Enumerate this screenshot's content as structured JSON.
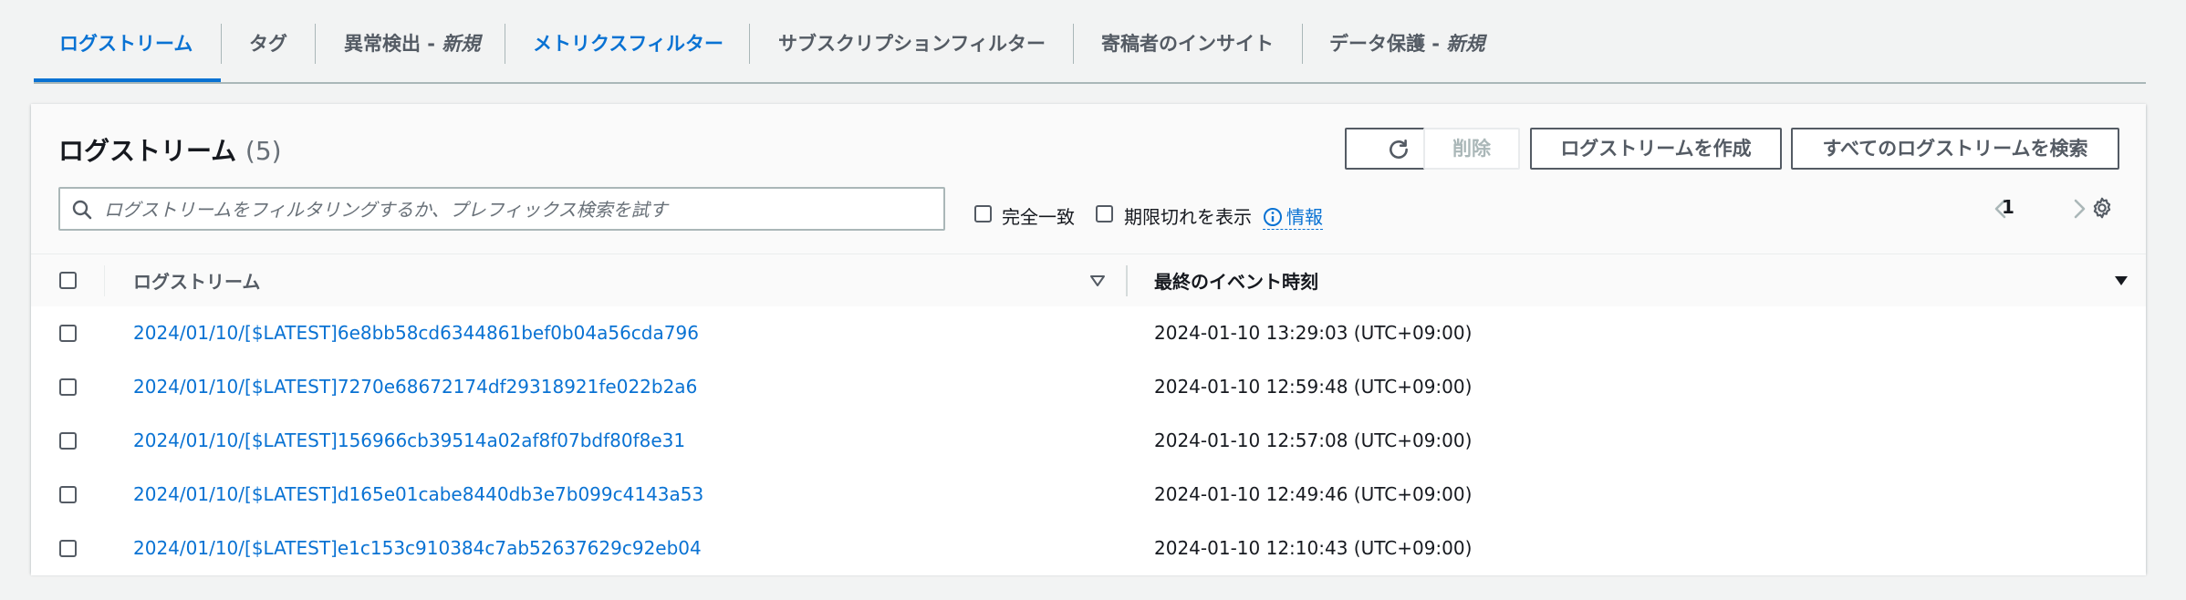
{
  "tabs": [
    {
      "label": "ログストリーム"
    },
    {
      "label": "タグ"
    },
    {
      "label": "異常検出 - ",
      "new": "新規"
    },
    {
      "label": "メトリクスフィルター"
    },
    {
      "label": "サブスクリプションフィルター"
    },
    {
      "label": "寄稿者のインサイト"
    },
    {
      "label": "データ保護 - ",
      "new": "新規"
    }
  ],
  "panel": {
    "title": "ログストリーム",
    "count": "(5)"
  },
  "toolbar": {
    "refresh_icon": "refresh-icon",
    "delete_label": "削除",
    "create_label": "ログストリームを作成",
    "search_all_label": "すべてのログストリームを検索"
  },
  "filter": {
    "placeholder": "ログストリームをフィルタリングするか、プレフィックス検索を試す",
    "exact_match_label": "完全一致",
    "show_expired_label": "期限切れを表示",
    "info_label": "情報"
  },
  "pagination": {
    "page": "1"
  },
  "table": {
    "columns": [
      "ログストリーム",
      "最終のイベント時刻"
    ],
    "rows": [
      {
        "stream": "2024/01/10/[$LATEST]6e8bb58cd6344861bef0b04a56cda796",
        "time": "2024-01-10 13:29:03 (UTC+09:00)"
      },
      {
        "stream": "2024/01/10/[$LATEST]7270e68672174df29318921fe022b2a6",
        "time": "2024-01-10 12:59:48 (UTC+09:00)"
      },
      {
        "stream": "2024/01/10/[$LATEST]156966cb39514a02af8f07bdf80f8e31",
        "time": "2024-01-10 12:57:08 (UTC+09:00)"
      },
      {
        "stream": "2024/01/10/[$LATEST]d165e01cabe8440db3e7b099c4143a53",
        "time": "2024-01-10 12:49:46 (UTC+09:00)"
      },
      {
        "stream": "2024/01/10/[$LATEST]e1c153c910384c7ab52637629c92eb04",
        "time": "2024-01-10 12:10:43 (UTC+09:00)"
      }
    ]
  },
  "colors": {
    "accent": "#0972d3",
    "text": "#16191f",
    "muted": "#545b64"
  }
}
